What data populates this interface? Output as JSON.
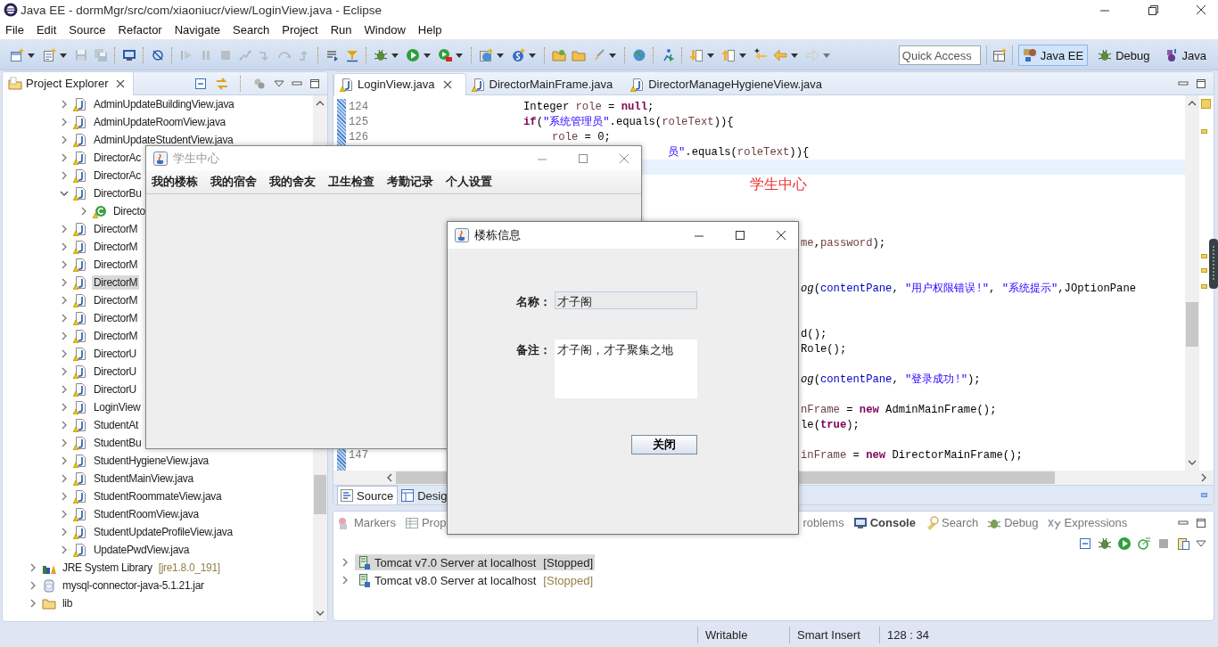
{
  "window": {
    "title": "Java EE - dormMgr/src/com/xiaoniucr/view/LoginView.java - Eclipse"
  },
  "menu": [
    "File",
    "Edit",
    "Source",
    "Refactor",
    "Navigate",
    "Search",
    "Project",
    "Run",
    "Window",
    "Help"
  ],
  "quick_access": {
    "placeholder": "Quick Access"
  },
  "perspectives": [
    {
      "label": "Java EE",
      "kind": "javaee",
      "selected": true
    },
    {
      "label": "Debug",
      "kind": "debug",
      "selected": false
    },
    {
      "label": "Java",
      "kind": "java",
      "selected": false
    }
  ],
  "project_explorer": {
    "title": "Project Explorer",
    "package_files": [
      {
        "label": "AdminUpdateBuildingView.java",
        "expanded": false,
        "selected": false
      },
      {
        "label": "AdminUpdateRoomView.java",
        "expanded": false,
        "selected": false
      },
      {
        "label": "AdminUpdateStudentView.java",
        "expanded": false,
        "selected": false
      },
      {
        "label": "DirectorAc",
        "expanded": false,
        "selected": false
      },
      {
        "label": "DirectorAc",
        "expanded": false,
        "selected": false
      },
      {
        "label": "DirectorBu",
        "expanded": true,
        "selected": false,
        "children": [
          {
            "label": "Directo",
            "expanded": false,
            "selected": false
          }
        ]
      },
      {
        "label": "DirectorM",
        "expanded": false,
        "selected": false
      },
      {
        "label": "DirectorM",
        "expanded": false,
        "selected": false
      },
      {
        "label": "DirectorM",
        "expanded": false,
        "selected": false
      },
      {
        "label": "DirectorM",
        "expanded": false,
        "selected": true
      },
      {
        "label": "DirectorM",
        "expanded": false,
        "selected": false
      },
      {
        "label": "DirectorM",
        "expanded": false,
        "selected": false
      },
      {
        "label": "DirectorM",
        "expanded": false,
        "selected": false
      },
      {
        "label": "DirectorU",
        "expanded": false,
        "selected": false
      },
      {
        "label": "DirectorU",
        "expanded": false,
        "selected": false
      },
      {
        "label": "DirectorU",
        "expanded": false,
        "selected": false
      },
      {
        "label": "LoginView",
        "expanded": false,
        "selected": false
      },
      {
        "label": "StudentAt",
        "expanded": false,
        "selected": false
      },
      {
        "label": "StudentBu",
        "expanded": false,
        "selected": false
      },
      {
        "label": "StudentHygieneView.java",
        "expanded": false,
        "selected": false
      },
      {
        "label": "StudentMainView.java",
        "expanded": false,
        "selected": false
      },
      {
        "label": "StudentRoommateView.java",
        "expanded": false,
        "selected": false
      },
      {
        "label": "StudentRoomView.java",
        "expanded": false,
        "selected": false
      },
      {
        "label": "StudentUpdateProfileView.java",
        "expanded": false,
        "selected": false
      },
      {
        "label": "UpdatePwdView.java",
        "expanded": false,
        "selected": false
      }
    ],
    "project_items": [
      {
        "label": "JRE System Library",
        "detail": "[jre1.8.0_191]",
        "kind": "library",
        "expanded": false
      },
      {
        "label": "mysql-connector-java-5.1.21.jar",
        "kind": "jar",
        "expanded": false
      },
      {
        "label": "lib",
        "kind": "folder",
        "expanded": false
      }
    ]
  },
  "editor": {
    "tabs": [
      {
        "label": "LoginView.java",
        "selected": true
      },
      {
        "label": "DirectorMainFrame.java",
        "selected": false
      },
      {
        "label": "DirectorManageHygieneView.java",
        "selected": false
      }
    ],
    "lines": [
      {
        "number": "124",
        "kind": "statement",
        "current": false,
        "tokens": [
          {
            "text": "Integer ",
            "kind": "plain"
          },
          {
            "text": "role",
            "kind": "local"
          },
          {
            "text": " = ",
            "kind": "plain"
          },
          {
            "text": "null",
            "kind": "keyword"
          },
          {
            "text": ";",
            "kind": "plain"
          }
        ]
      },
      {
        "number": "125",
        "kind": "statement",
        "current": false,
        "tokens": [
          {
            "text": "if",
            "kind": "keyword"
          },
          {
            "text": "(",
            "kind": "plain"
          },
          {
            "text": "\"系统管理员\"",
            "kind": "string"
          },
          {
            "text": ".equals(",
            "kind": "plain"
          },
          {
            "text": "roleText",
            "kind": "local"
          },
          {
            "text": ")){",
            "kind": "plain"
          }
        ]
      },
      {
        "number": "126",
        "kind": "nested",
        "current": false,
        "tokens": [
          {
            "text": "role",
            "kind": "local"
          },
          {
            "text": " = 0;",
            "kind": "plain"
          }
        ]
      },
      {
        "kind": "middle",
        "current": false,
        "tokens": [
          {
            "text": "员\"",
            "kind": "string"
          },
          {
            "text": ".equals(",
            "kind": "plain"
          },
          {
            "text": "roleText",
            "kind": "local"
          },
          {
            "text": ")){",
            "kind": "plain"
          }
        ]
      },
      {
        "kind": "blank",
        "current": true
      },
      {
        "kind": "blank",
        "current": false
      },
      {
        "kind": "blank",
        "current": false
      },
      {
        "kind": "blank",
        "current": false
      },
      {
        "kind": "blank",
        "current": false
      },
      {
        "kind": "fragment",
        "current": false,
        "tokens": [
          {
            "text": "me",
            "kind": "local"
          },
          {
            "text": ",",
            "kind": "plain"
          },
          {
            "text": "password",
            "kind": "local"
          },
          {
            "text": ");",
            "kind": "plain"
          }
        ]
      },
      {
        "kind": "blank",
        "current": false
      },
      {
        "kind": "blank",
        "current": false
      },
      {
        "kind": "fragment",
        "current": false,
        "tokens": [
          {
            "text": "og",
            "kind": "static"
          },
          {
            "text": "(",
            "kind": "plain"
          },
          {
            "text": "contentPane",
            "kind": "field"
          },
          {
            "text": ", ",
            "kind": "plain"
          },
          {
            "text": "\"用户权限错误!\"",
            "kind": "string"
          },
          {
            "text": ", ",
            "kind": "plain"
          },
          {
            "text": "\"系统提示\"",
            "kind": "string"
          },
          {
            "text": ",JOptionPane",
            "kind": "plain"
          }
        ]
      },
      {
        "kind": "blank",
        "current": false
      },
      {
        "kind": "blank",
        "current": false
      },
      {
        "kind": "fragment",
        "current": false,
        "tokens": [
          {
            "text": "d();",
            "kind": "plain"
          }
        ]
      },
      {
        "kind": "fragment",
        "current": false,
        "tokens": [
          {
            "text": "Role();",
            "kind": "plain"
          }
        ]
      },
      {
        "kind": "blank",
        "current": false
      },
      {
        "kind": "fragment",
        "current": false,
        "tokens": [
          {
            "text": "og",
            "kind": "static"
          },
          {
            "text": "(",
            "kind": "plain"
          },
          {
            "text": "contentPane",
            "kind": "field"
          },
          {
            "text": ", ",
            "kind": "plain"
          },
          {
            "text": "\"登录成功!\"",
            "kind": "string"
          },
          {
            "text": ");",
            "kind": "plain"
          }
        ]
      },
      {
        "kind": "blank",
        "current": false
      },
      {
        "kind": "fragment",
        "current": false,
        "tokens": [
          {
            "text": "nFrame",
            "kind": "local"
          },
          {
            "text": " = ",
            "kind": "plain"
          },
          {
            "text": "new",
            "kind": "keyword"
          },
          {
            "text": " AdminMainFrame();",
            "kind": "plain"
          }
        ]
      },
      {
        "kind": "fragment",
        "current": false,
        "tokens": [
          {
            "text": "le(",
            "kind": "plain"
          },
          {
            "text": "true",
            "kind": "keyword"
          },
          {
            "text": ");",
            "kind": "plain"
          }
        ]
      },
      {
        "kind": "blank",
        "current": false
      },
      {
        "number": "147",
        "kind": "fragment",
        "current": false,
        "tokens": [
          {
            "text": "inFrame",
            "kind": "local"
          },
          {
            "text": " = ",
            "kind": "plain"
          },
          {
            "text": "new",
            "kind": "keyword"
          },
          {
            "text": " DirectorMainFrame();",
            "kind": "plain"
          }
        ]
      }
    ],
    "caption": "学生中心",
    "view_tabs": [
      {
        "label": "Source",
        "kind": "source",
        "selected": true
      },
      {
        "label": "Desig",
        "kind": "design",
        "selected": false
      }
    ]
  },
  "bottom_panel": {
    "tabs": [
      {
        "label": "Markers",
        "kind": "markers",
        "bold": false
      },
      {
        "label": "Prop",
        "kind": "properties",
        "bold": false
      },
      {
        "label": "roblems",
        "kind": "problems",
        "bold": false
      },
      {
        "label": "Console",
        "kind": "console",
        "bold": true
      },
      {
        "label": "Search",
        "kind": "search",
        "bold": false
      },
      {
        "label": "Debug",
        "kind": "debug",
        "bold": false
      },
      {
        "label": "Expressions",
        "kind": "expressions",
        "bold": false
      }
    ],
    "servers": [
      {
        "name": "Tomcat v7.0 Server at localhost",
        "status": "[Stopped]",
        "selected": true
      },
      {
        "name": "Tomcat v8.0 Server at localhost",
        "status": "[Stopped]",
        "selected": false
      }
    ]
  },
  "status_bar": [
    "Writable",
    "Smart Insert",
    "128 : 34"
  ],
  "student_window": {
    "title": "学生中心",
    "active": false,
    "menu": [
      "我的楼栋",
      "我的宿舍",
      "我的舍友",
      "卫生检查",
      "考勤记录",
      "个人设置"
    ]
  },
  "dialog": {
    "title": "楼栋信息",
    "active": true,
    "fields": [
      {
        "label": "名称：",
        "value": "才子阁",
        "kind": "text",
        "editable": false
      },
      {
        "label": "备注：",
        "value": "才子阁，才子聚集之地",
        "kind": "textarea",
        "editable": true
      }
    ],
    "button": "关闭"
  }
}
